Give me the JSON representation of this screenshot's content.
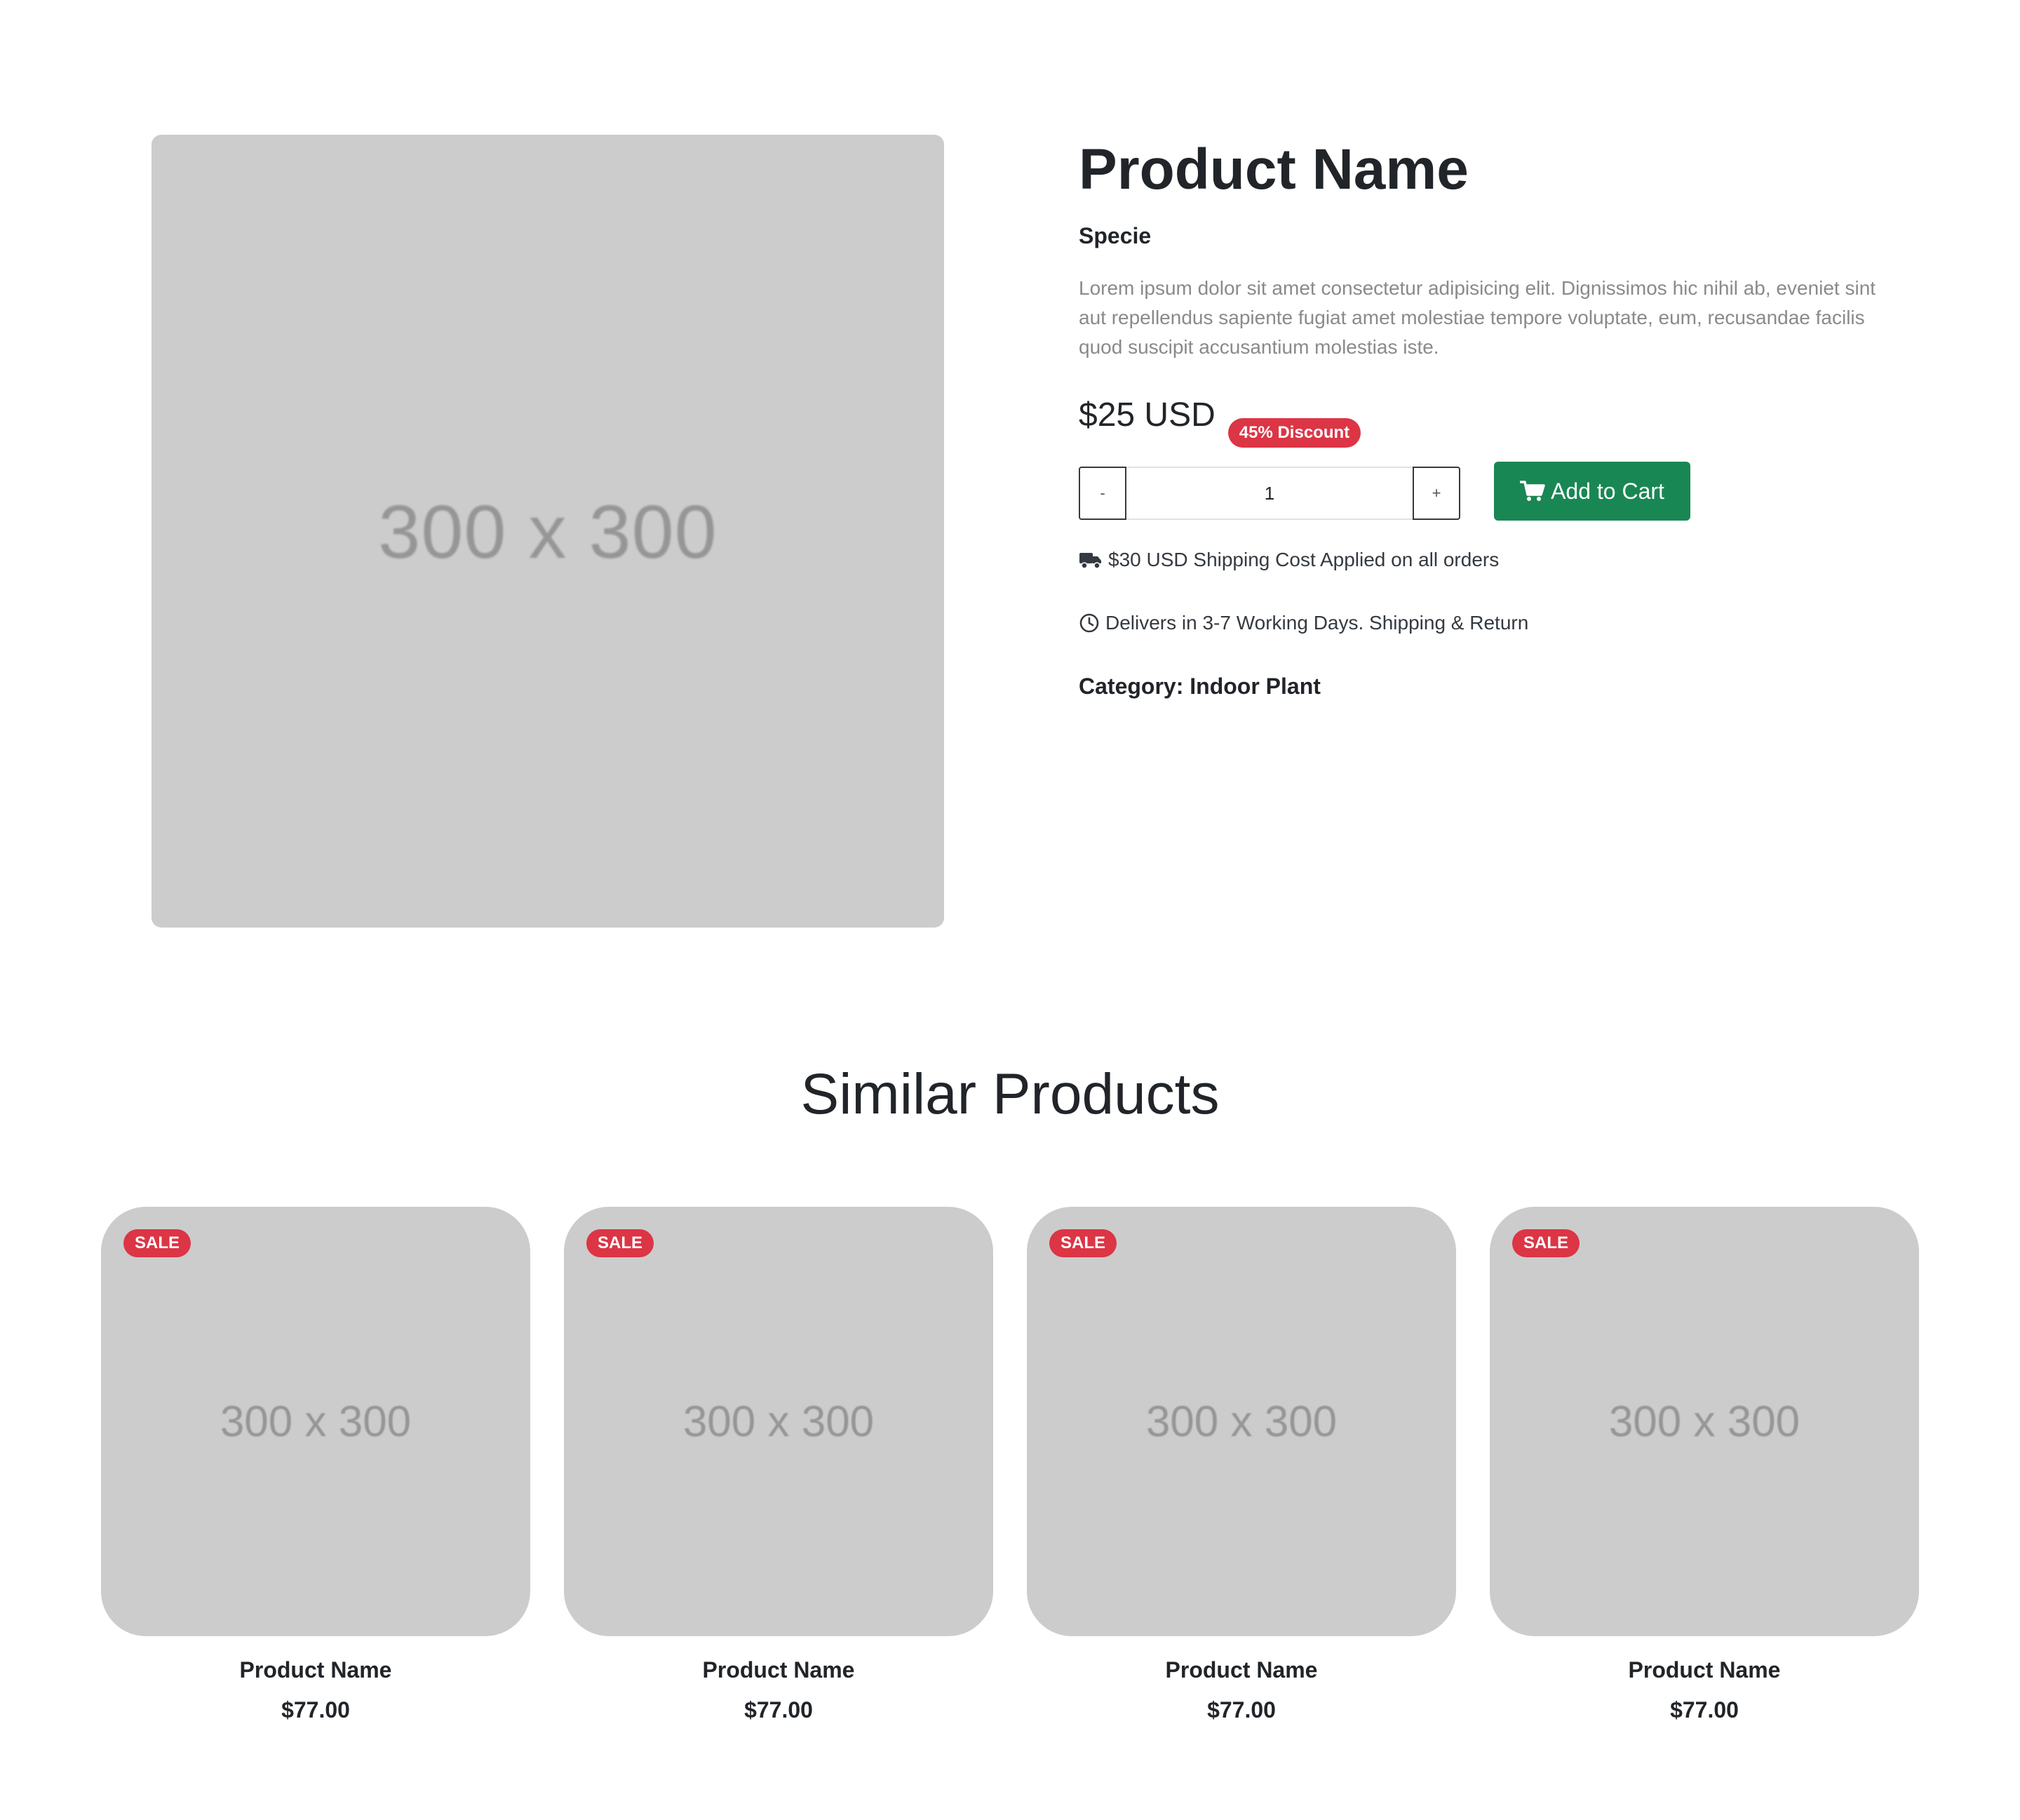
{
  "product": {
    "image_placeholder": "300 x 300",
    "title": "Product Name",
    "specie": "Specie",
    "description": "Lorem ipsum dolor sit amet consectetur adipisicing elit. Dignissimos hic nihil ab, eveniet sint aut repellendus sapiente fugiat amet molestiae tempore voluptate, eum, recusandae facilis quod suscipit accusantium molestias iste.",
    "price": "$25 USD",
    "discount_badge": "45% Discount",
    "quantity": {
      "minus_label": "-",
      "value": "1",
      "plus_label": "+"
    },
    "add_to_cart_label": "Add to Cart",
    "shipping_text": "$30 USD Shipping Cost Applied on all orders",
    "delivery_text": "Delivers in 3-7 Working Days. Shipping & Return",
    "category_text": "Category: Indoor Plant"
  },
  "similar": {
    "title": "Similar Products",
    "items": [
      {
        "badge": "SALE",
        "image_placeholder": "300 x 300",
        "name": "Product Name",
        "price": "$77.00"
      },
      {
        "badge": "SALE",
        "image_placeholder": "300 x 300",
        "name": "Product Name",
        "price": "$77.00"
      },
      {
        "badge": "SALE",
        "image_placeholder": "300 x 300",
        "name": "Product Name",
        "price": "$77.00"
      },
      {
        "badge": "SALE",
        "image_placeholder": "300 x 300",
        "name": "Product Name",
        "price": "$77.00"
      }
    ]
  },
  "colors": {
    "accent_green": "#198754",
    "badge_red": "#dc3545",
    "placeholder_gray": "#cccccc",
    "text_dark": "#212529",
    "text_muted": "#8a8a8a"
  },
  "icons": {
    "shipping": "truck-icon",
    "delivery": "clock-icon",
    "cart": "shopping-cart-icon"
  }
}
